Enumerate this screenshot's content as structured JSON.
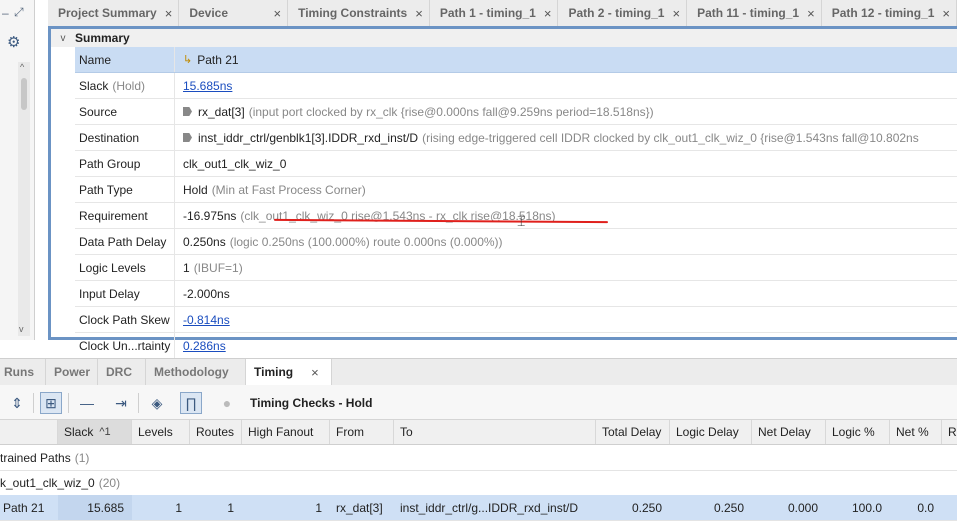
{
  "top_tabs": [
    {
      "label": "Project Summary",
      "width": 140
    },
    {
      "label": "Device",
      "width": 128
    },
    {
      "label": "Timing Constraints",
      "width": 149
    },
    {
      "label": "Path 1 - timing_1",
      "width": 137
    },
    {
      "label": "Path 2 - timing_1",
      "width": 137
    },
    {
      "label": "Path 11 - timing_1",
      "width": 144
    },
    {
      "label": "Path 12 - timing_1",
      "width": 140
    }
  ],
  "close_glyph": "×",
  "summary": {
    "title": "Summary",
    "rows": [
      {
        "key": "Name",
        "value": "Path 21"
      },
      {
        "key": "Slack",
        "key_note": "(Hold)",
        "value": "15.685ns"
      },
      {
        "key": "Source",
        "value": "rx_dat[3]",
        "note": "(input port clocked by rx_clk  {rise@0.000ns fall@9.259ns period=18.518ns})"
      },
      {
        "key": "Destination",
        "value": "inst_iddr_ctrl/genblk1[3].IDDR_rxd_inst/D",
        "note": "(rising edge-triggered cell IDDR clocked by clk_out1_clk_wiz_0  {rise@1.543ns fall@10.802ns"
      },
      {
        "key": "Path Group",
        "value": "clk_out1_clk_wiz_0"
      },
      {
        "key": "Path Type",
        "value": "Hold",
        "note": "(Min at Fast Process Corner)"
      },
      {
        "key": "Requirement",
        "value": "-16.975ns",
        "note": "(clk_out1_clk_wiz_0 rise@1.543ns - rx_clk rise@18.518ns)"
      },
      {
        "key": "Data Path Delay",
        "value": "0.250ns",
        "note": "(logic 0.250ns (100.000%)  route 0.000ns (0.000%))"
      },
      {
        "key": "Logic Levels",
        "value": "1",
        "note": "(IBUF=1)"
      },
      {
        "key": "Input Delay",
        "value": "-2.000ns"
      },
      {
        "key": "Clock Path Skew",
        "value": "-0.814ns"
      },
      {
        "key": "Clock Un...rtainty",
        "value": "0.286ns"
      }
    ]
  },
  "bottom_tabs": [
    {
      "label": "Runs",
      "width": 46
    },
    {
      "label": "Power",
      "width": 52
    },
    {
      "label": "DRC",
      "width": 48
    },
    {
      "label": "Methodology",
      "width": 100
    },
    {
      "label": "Timing",
      "width": 86
    }
  ],
  "toolbar": {
    "label": "Timing Checks - Hold"
  },
  "table": {
    "columns": [
      "Slack",
      "Levels",
      "Routes",
      "High Fanout",
      "From",
      "To",
      "Total Delay",
      "Logic Delay",
      "Net Delay",
      "Logic %",
      "Net %",
      "Re"
    ],
    "sort_indicator": "^1",
    "group_rows": [
      {
        "label": "trained Paths",
        "count": "(1)"
      },
      {
        "label": "k_out1_clk_wiz_0",
        "count": "(20)"
      }
    ],
    "path_row": {
      "name": "Path 21",
      "slack": "15.685",
      "levels": "1",
      "routes": "1",
      "high_fanout": "1",
      "from": "rx_dat[3]",
      "to": "inst_iddr_ctrl/g...IDDR_rxd_inst/D",
      "total_delay": "0.250",
      "logic_delay": "0.250",
      "net_delay": "0.000",
      "logic_pct": "100.0",
      "net_pct": "0.0"
    }
  },
  "colors": {
    "selection": "#c9dcf3",
    "frame": "#6b93c4",
    "link": "#1a4dbf",
    "annotation": "#e0201c"
  }
}
